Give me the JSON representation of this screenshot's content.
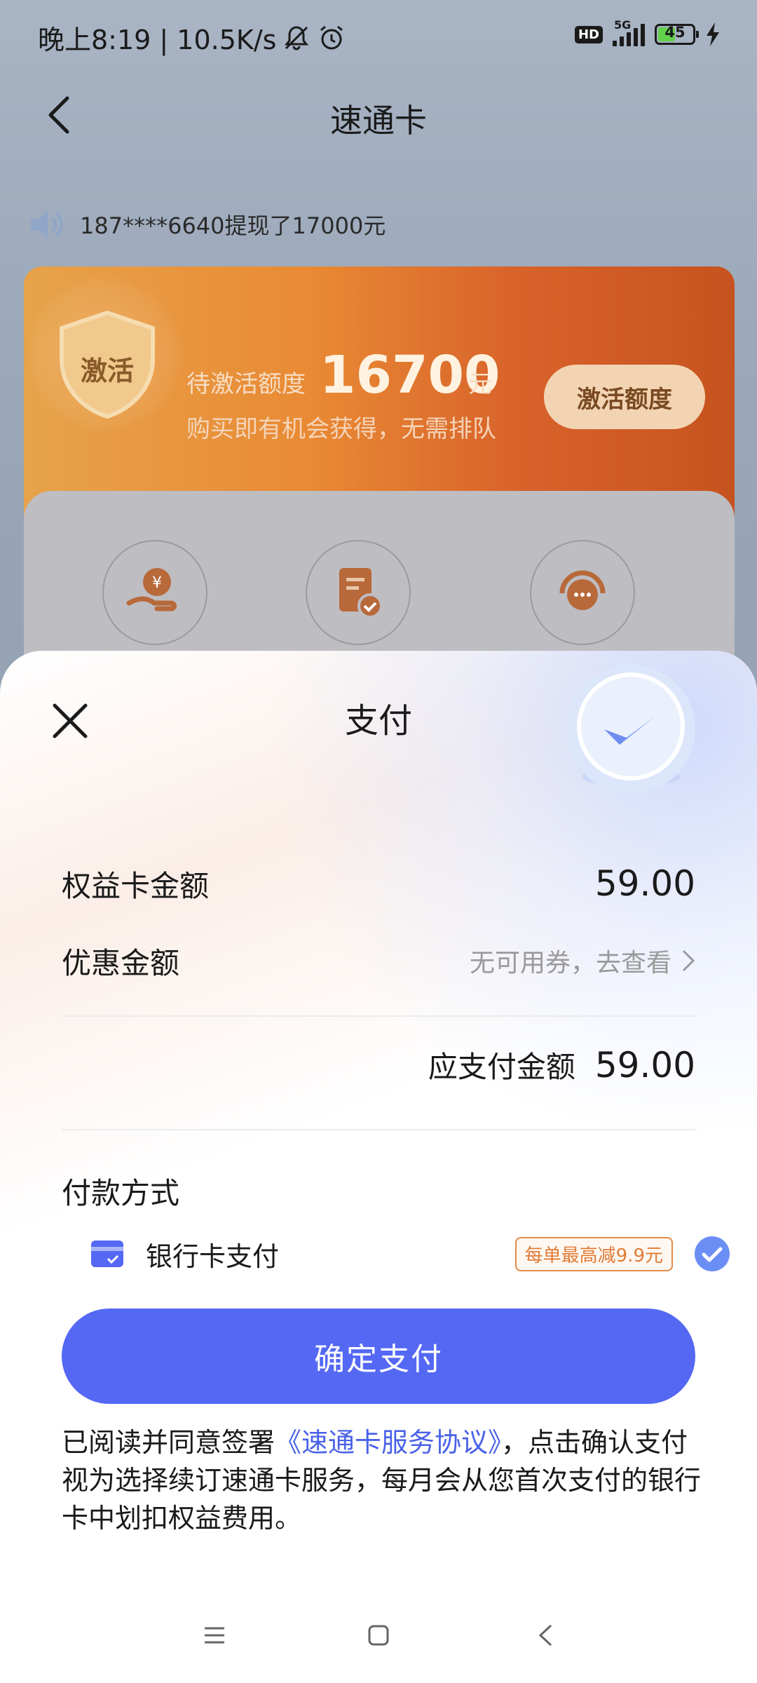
{
  "status_bar": {
    "time_speed": "晚上8:19 | 10.5K/s",
    "hd": "HD",
    "network": "5G",
    "battery": "45"
  },
  "header": {
    "title": "速通卡"
  },
  "notice": {
    "text": "187****6640提现了17000元"
  },
  "activate_card": {
    "shield_label": "激活",
    "pending_label": "待激活额度",
    "pending_amount": "16700",
    "pending_unit": "元",
    "subtitle": "购买即有机会获得，无需排队",
    "button": "激活额度"
  },
  "sheet": {
    "title": "支付",
    "card_amount_label": "权益卡金额",
    "card_amount_value": "59.00",
    "discount_label": "优惠金额",
    "discount_link": "无可用券，去查看",
    "total_label": "应支付金额",
    "total_value": "59.00",
    "payment_title": "付款方式",
    "payment_method": "银行卡支付",
    "promo": "每单最高减9.9元",
    "confirm_button": "确定支付",
    "agreement_prefix": "已阅读并同意签署",
    "agreement_link": "《速通卡服务协议》",
    "agreement_suffix": "，点击确认支付视为选择续订速通卡服务，每月会从您首次支付的银行卡中划扣权益费用。"
  },
  "colors": {
    "accent": "#5468f4",
    "orange": "#e98a34",
    "promo": "#e07b36"
  }
}
